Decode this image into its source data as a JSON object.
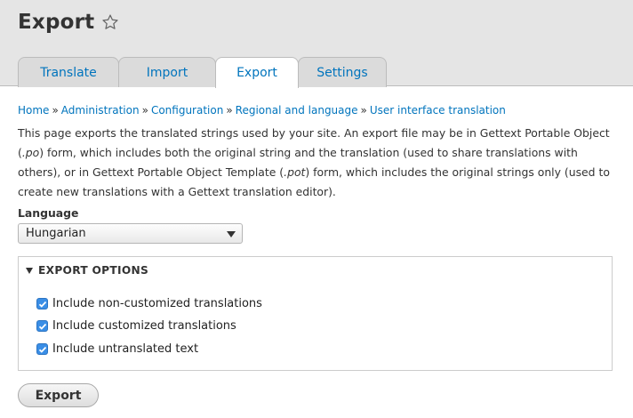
{
  "page": {
    "title": "Export"
  },
  "tabs": [
    {
      "label": "Translate",
      "active": false
    },
    {
      "label": "Import",
      "active": false
    },
    {
      "label": "Export",
      "active": true
    },
    {
      "label": "Settings",
      "active": false
    }
  ],
  "breadcrumb": {
    "items": [
      "Home",
      "Administration",
      "Configuration",
      "Regional and language",
      "User interface translation"
    ],
    "separator": "»"
  },
  "description": {
    "part1": "This page exports the translated strings used by your site. An export file may be in Gettext Portable Object (",
    "po": ".po",
    "part2": ") form, which includes both the original string and the translation (used to share translations with others), or in Gettext Portable Object Template (",
    "pot": ".pot",
    "part3": ") form, which includes the original strings only (used to create new translations with a Gettext translation editor)."
  },
  "language": {
    "label": "Language",
    "selected": "Hungarian"
  },
  "export_options": {
    "legend": "EXPORT OPTIONS",
    "options": [
      {
        "label": "Include non-customized translations",
        "checked": true
      },
      {
        "label": "Include customized translations",
        "checked": true
      },
      {
        "label": "Include untranslated text",
        "checked": true
      }
    ]
  },
  "actions": {
    "export_label": "Export"
  },
  "colors": {
    "link": "#0074bd",
    "header_bg": "#e5e5e5",
    "checkbox": "#3a8ee6"
  }
}
